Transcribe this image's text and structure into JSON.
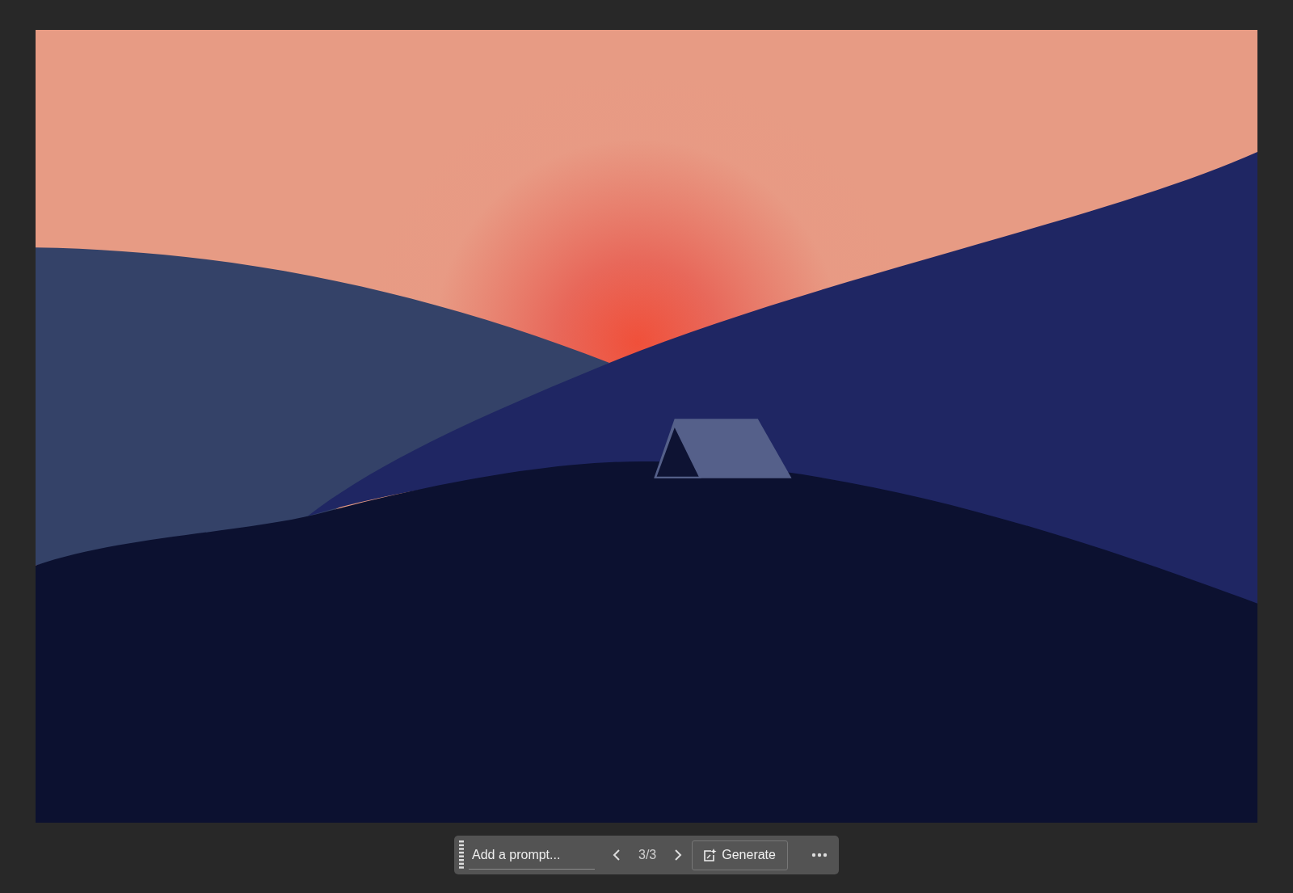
{
  "prompt_bar": {
    "placeholder": "Add a prompt...",
    "counter": "3/3",
    "generate_label": "Generate"
  }
}
